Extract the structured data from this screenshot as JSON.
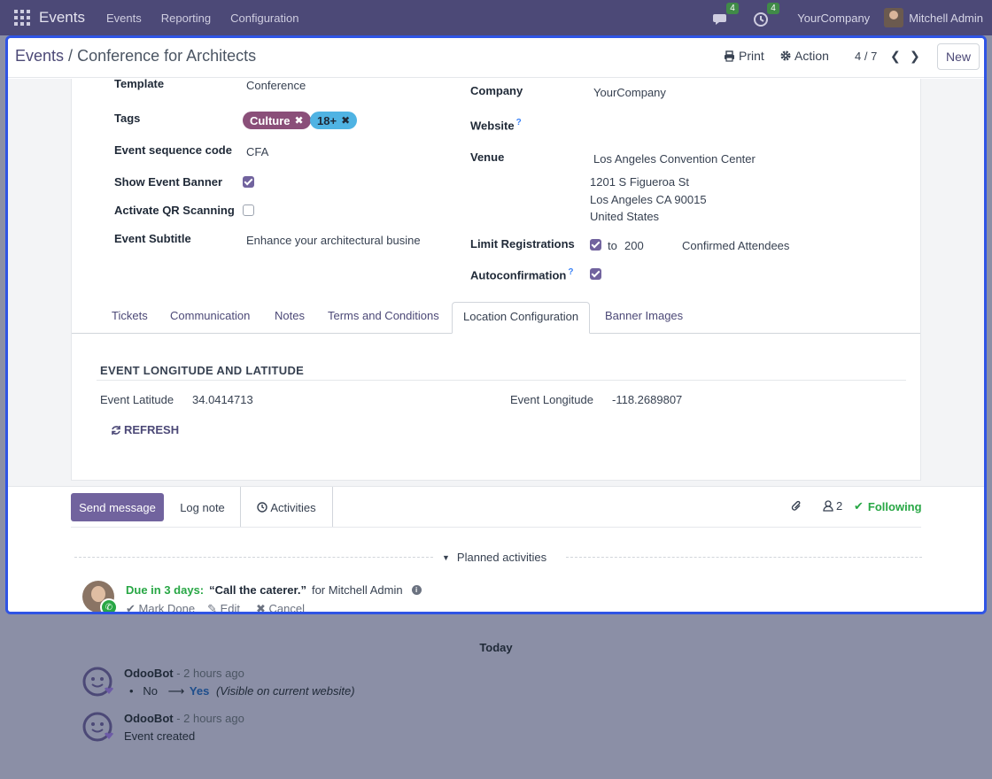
{
  "navbar": {
    "brand": "Events",
    "menus": [
      "Events",
      "Reporting",
      "Configuration"
    ],
    "messages_count": "4",
    "activities_count": "4",
    "company": "YourCompany",
    "user": "Mitchell Admin"
  },
  "control_panel": {
    "breadcrumb_parent": "Events",
    "breadcrumb_sep": "/",
    "breadcrumb_current": "Conference for Architects",
    "print_label": "Print",
    "action_label": "Action",
    "pager": "4 / 7",
    "new_label": "New"
  },
  "form": {
    "left": {
      "template_label": "Template",
      "template_value": "Conference",
      "tags_label": "Tags",
      "tags": [
        {
          "name": "Culture",
          "color": "#8a4f79"
        },
        {
          "name": "18+",
          "color": "#4fb3e3"
        }
      ],
      "sequence_label": "Event sequence code",
      "sequence_value": "CFA",
      "banner_label": "Show Event Banner",
      "banner_checked": true,
      "qr_label": "Activate QR Scanning",
      "qr_checked": false,
      "subtitle_label": "Event Subtitle",
      "subtitle_value": "Enhance your architectural busine"
    },
    "right": {
      "company_label": "Company",
      "company_value": "YourCompany",
      "website_label": "Website",
      "website_help": "?",
      "venue_label": "Venue",
      "venue_name": "Los Angeles Convention Center",
      "venue_line1": "1201 S Figueroa St",
      "venue_line2": "Los Angeles CA 90015",
      "venue_line3": "United States",
      "limit_label": "Limit Registrations",
      "limit_checked": true,
      "limit_to": "to",
      "limit_value": "200",
      "limit_unit": "Confirmed Attendees",
      "autoconf_label": "Autoconfirmation",
      "autoconf_help": "?",
      "autoconf_checked": true
    },
    "tabs": [
      {
        "label": "Tickets"
      },
      {
        "label": "Communication"
      },
      {
        "label": "Notes"
      },
      {
        "label": "Terms and Conditions"
      },
      {
        "label": "Location Configuration",
        "active": true
      },
      {
        "label": "Banner Images"
      }
    ],
    "location": {
      "section_title": "EVENT LONGITUDE AND LATITUDE",
      "latitude_label": "Event Latitude",
      "latitude_value": "34.0414713",
      "longitude_label": "Event Longitude",
      "longitude_value": "-118.2689807",
      "refresh_label": "REFRESH"
    }
  },
  "chatter": {
    "send_label": "Send message",
    "log_label": "Log note",
    "activities_label": "Activities",
    "followers_count": "2",
    "following_label": "Following",
    "planned_label": "Planned activities",
    "activity": {
      "due": "Due in 3 days:",
      "summary": "“Call the caterer.”",
      "for_text": "for Mitchell Admin",
      "mark_done": "Mark Done",
      "edit": "Edit",
      "cancel": "Cancel"
    }
  },
  "messages": {
    "today_label": "Today",
    "items": [
      {
        "author": "OdooBot",
        "time": "- 2 hours ago",
        "change_old": "No",
        "change_new": "Yes",
        "change_note": "(Visible on current website)"
      },
      {
        "author": "OdooBot",
        "time": "- 2 hours ago",
        "body": "Event created"
      }
    ]
  }
}
